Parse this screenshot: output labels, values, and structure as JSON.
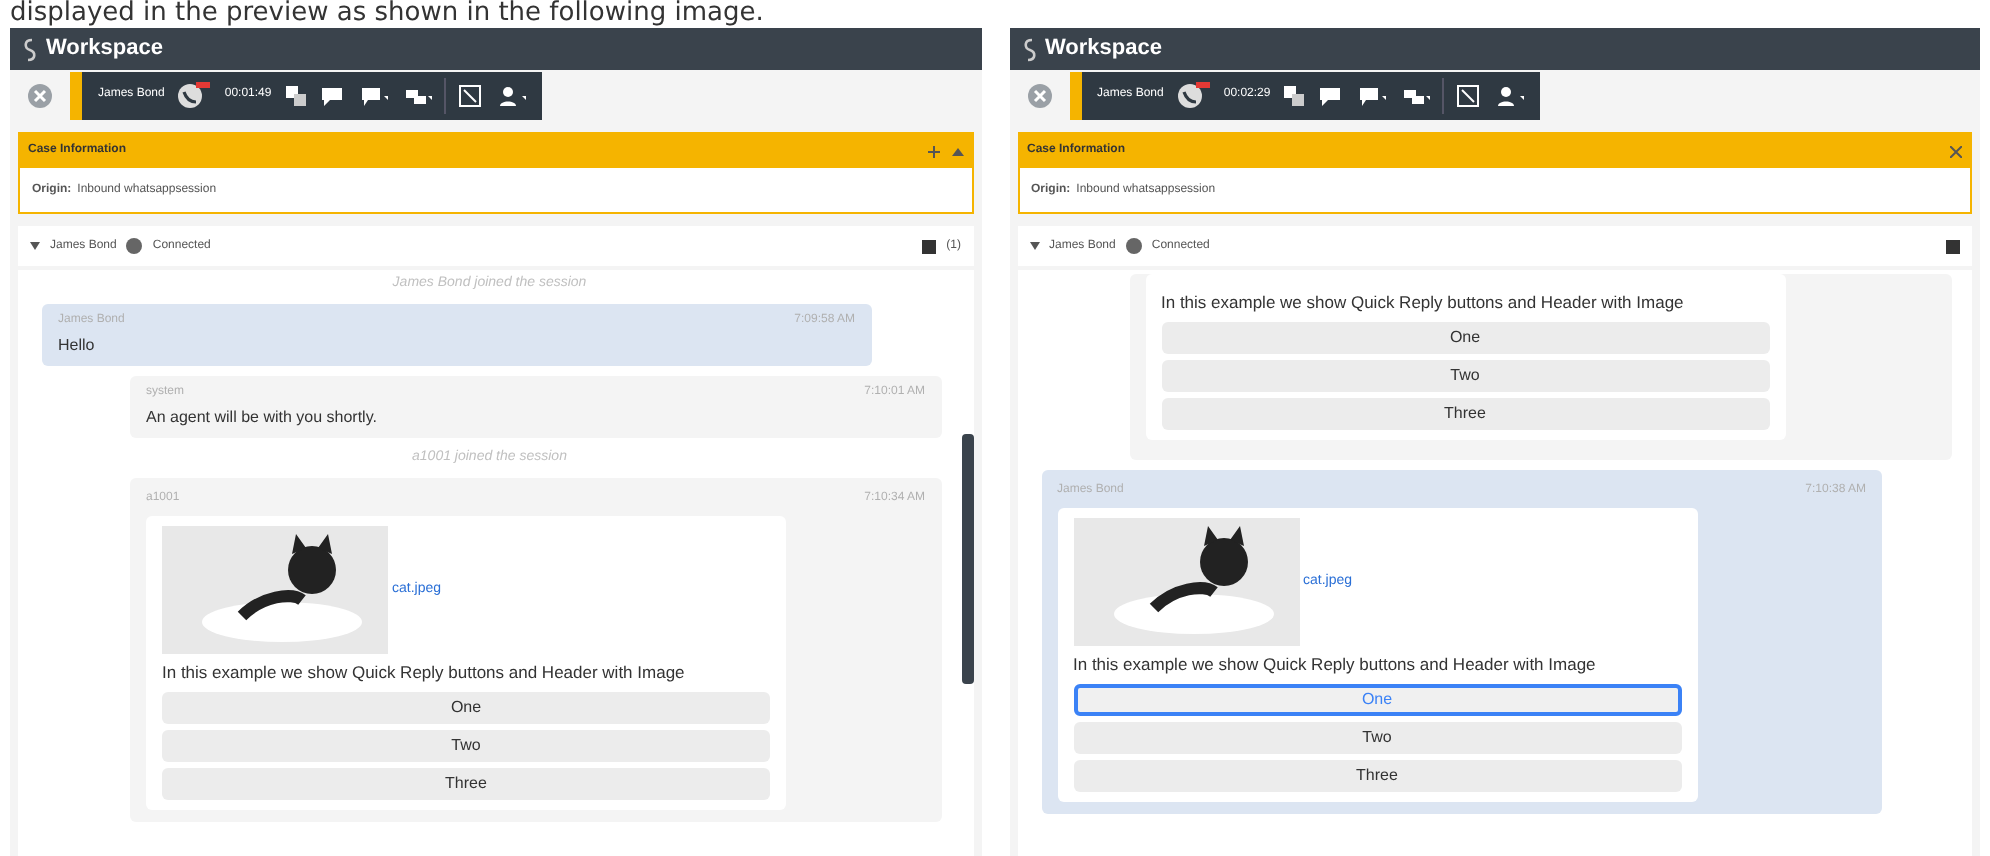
{
  "caption": "displayed in the preview as shown in the following image.",
  "panels": [
    {
      "title": "Workspace",
      "contact": "James Bond",
      "timer": "00:01:49",
      "case_title": "Case Information",
      "case_icons": [
        {
          "kind": "add"
        },
        {
          "kind": "collapse"
        }
      ],
      "origin_label": "Origin:",
      "origin": "Inbound whatsappsession",
      "participant": "James Bond",
      "status": "Connected",
      "count": "(1)",
      "scrollbar": true,
      "messages": [
        {
          "kind": "event",
          "text": "James Bond joined the session"
        },
        {
          "kind": "customer_message",
          "sender": "James Bond",
          "time": "7:09:58 AM",
          "text": "Hello"
        },
        {
          "kind": "agent_message",
          "sender": "system",
          "time": "7:10:01 AM",
          "text": "An agent will be with you shortly."
        },
        {
          "kind": "event",
          "text": "a1001 joined the session"
        },
        {
          "kind": "agent_card",
          "sender": "a1001",
          "time": "7:10:34 AM",
          "file": "cat.jpeg",
          "text": "In this example we show Quick Reply buttons and Header with Image",
          "options": [
            {
              "label": "One",
              "selected": false
            },
            {
              "label": "Two",
              "selected": false
            },
            {
              "label": "Three",
              "selected": false
            }
          ]
        }
      ]
    },
    {
      "title": "Workspace",
      "contact": "James Bond",
      "timer": "00:02:29",
      "case_title": "Case Information",
      "case_icons": [
        {
          "kind": "close"
        }
      ],
      "origin_label": "Origin:",
      "origin": "Inbound whatsappsession",
      "participant": "James Bond",
      "status": "Connected",
      "scrollbar": false,
      "messages": [
        {
          "kind": "agent_card",
          "text": "In this example we show Quick Reply buttons and Header with Image",
          "options": [
            {
              "label": "One",
              "selected": false
            },
            {
              "label": "Two",
              "selected": false
            },
            {
              "label": "Three",
              "selected": false
            }
          ]
        },
        {
          "kind": "customer_card",
          "sender": "James Bond",
          "time": "7:10:38 AM",
          "file": "cat.jpeg",
          "text": "In this example we show Quick Reply buttons and Header with Image",
          "options": [
            {
              "label": "One",
              "selected": true
            },
            {
              "label": "Two",
              "selected": false
            },
            {
              "label": "Three",
              "selected": false
            }
          ]
        }
      ]
    }
  ]
}
